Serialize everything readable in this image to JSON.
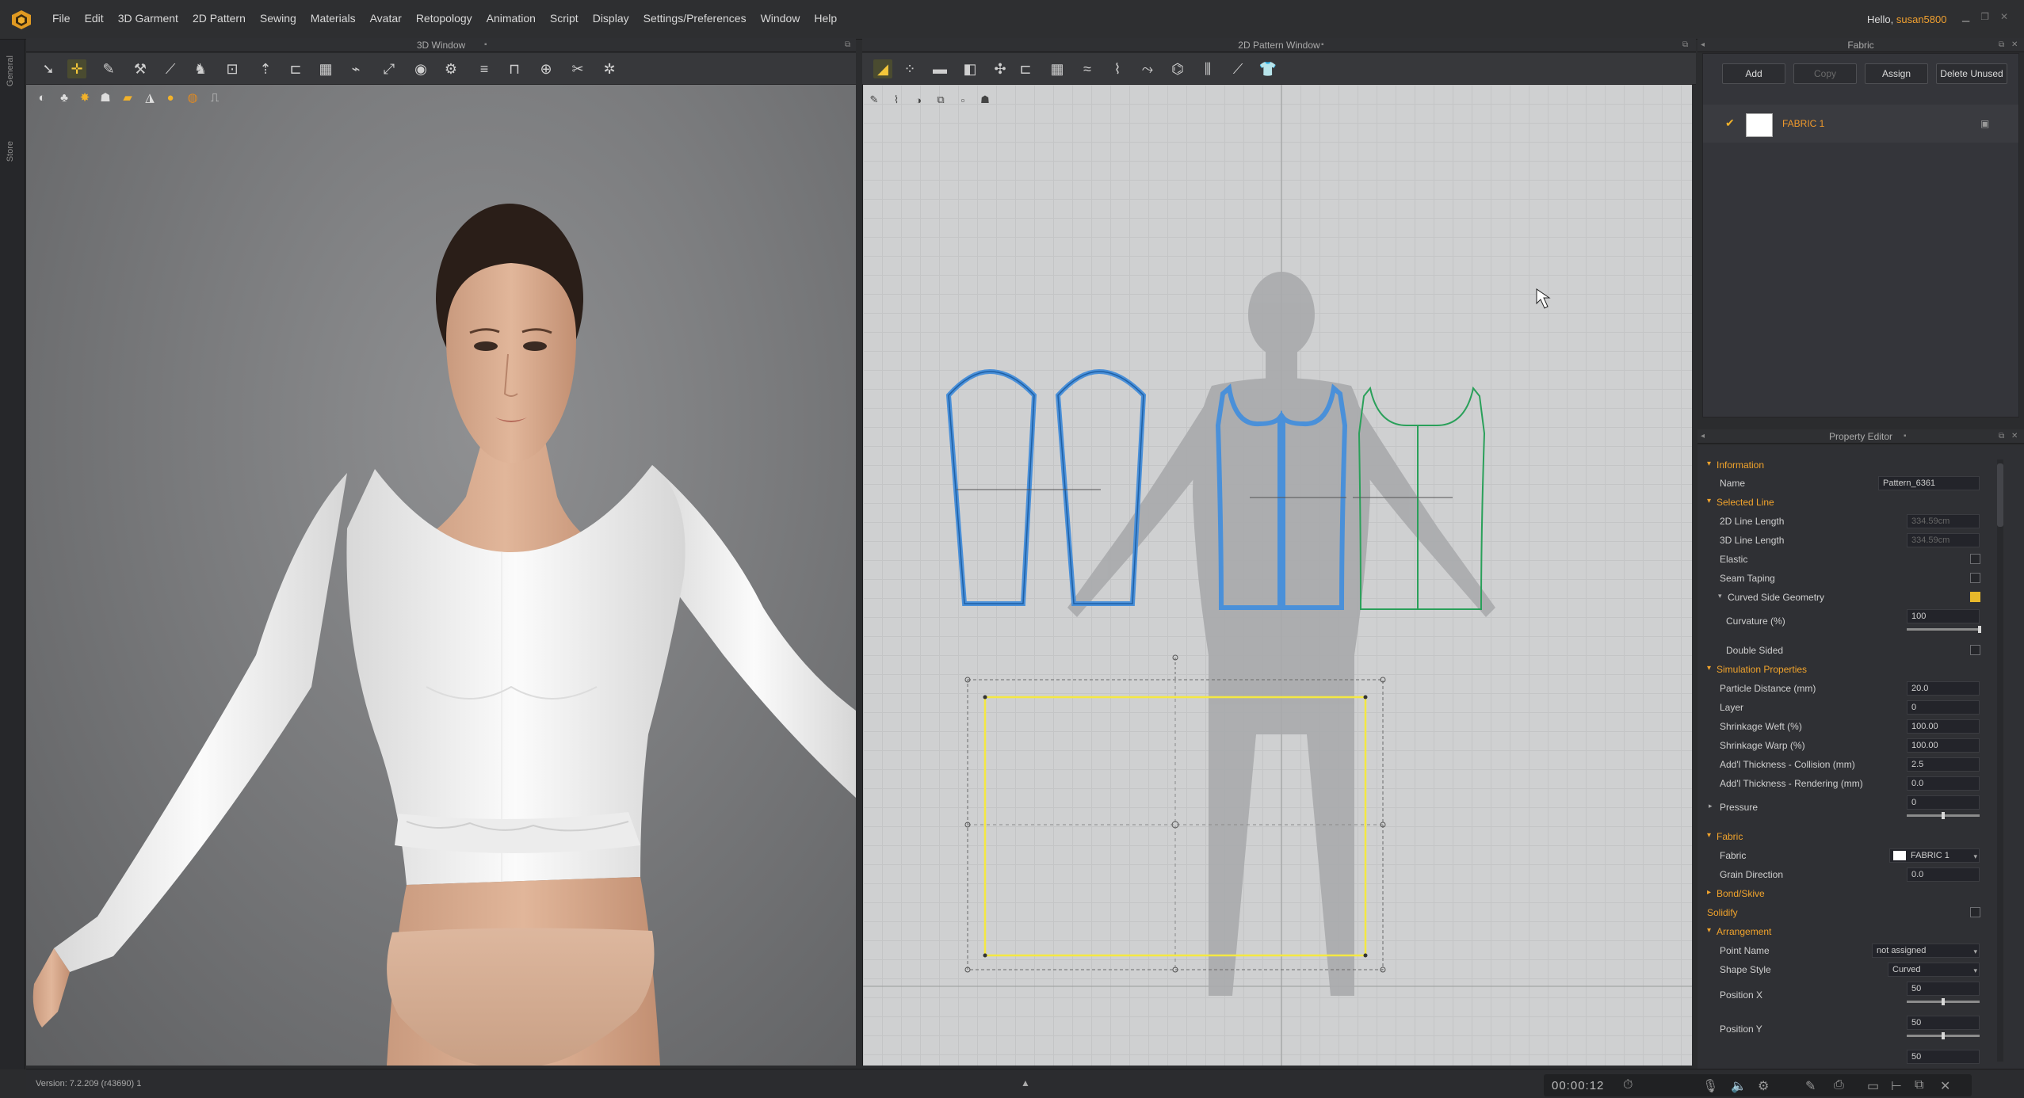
{
  "app": {
    "menus": [
      "File",
      "Edit",
      "3D Garment",
      "2D Pattern",
      "Sewing",
      "Materials",
      "Avatar",
      "Retopology",
      "Animation",
      "Script",
      "Display",
      "Settings/Preferences",
      "Window",
      "Help"
    ],
    "hello_prefix": "Hello, ",
    "username": "susan5800"
  },
  "left_tabs": [
    "General",
    "Store"
  ],
  "panels": {
    "window3d_title": "3D Window",
    "window2d_title": "2D Pattern Window",
    "fabric_title": "Fabric",
    "property_title": "Property Editor"
  },
  "fabric": {
    "buttons": [
      {
        "label": "Add",
        "enabled": true
      },
      {
        "label": "Copy",
        "enabled": false
      },
      {
        "label": "Assign",
        "enabled": true
      },
      {
        "label": "Delete Unused",
        "enabled": true
      }
    ],
    "items": [
      {
        "name": "FABRIC 1",
        "swatch_color": "#ffffff"
      }
    ]
  },
  "property": {
    "information": "Information",
    "name_label": "Name",
    "name_value": "Pattern_6361",
    "selected_line": "Selected Line",
    "line2d_label": "2D Line Length",
    "line2d_value": "334.59cm",
    "line3d_label": "3D Line Length",
    "line3d_value": "334.59cm",
    "elastic_label": "Elastic",
    "seam_taping_label": "Seam Taping",
    "curved_side_label": "Curved Side Geometry",
    "curvature_label": "Curvature (%)",
    "curvature_value": "100",
    "curvature_level": 1.0,
    "double_sided_label": "Double Sided",
    "sim_props": "Simulation Properties",
    "particle_label": "Particle Distance (mm)",
    "particle_value": "20.0",
    "layer_label": "Layer",
    "layer_value": "0",
    "shrink_weft_label": "Shrinkage Weft (%)",
    "shrink_weft_value": "100.00",
    "shrink_warp_label": "Shrinkage Warp (%)",
    "shrink_warp_value": "100.00",
    "thick_coll_label": "Add'l Thickness - Collision (mm)",
    "thick_coll_value": "2.5",
    "thick_rend_label": "Add'l Thickness - Rendering (mm)",
    "thick_rend_value": "0.0",
    "pressure_label": "Pressure",
    "pressure_value": "0",
    "pressure_level": 0.5,
    "fabric_section": "Fabric",
    "fabric_label": "Fabric",
    "fabric_value": "FABRIC 1",
    "grain_label": "Grain Direction",
    "grain_value": "0.0",
    "bond_skive": "Bond/Skive",
    "solidify": "Solidify",
    "arrangement": "Arrangement",
    "point_name_label": "Point Name",
    "point_name_value": "not assigned",
    "shape_style_label": "Shape Style",
    "shape_style_value": "Curved",
    "pos_x_label": "Position X",
    "pos_x_value": "50",
    "pos_x_level": 0.5,
    "pos_y_label": "Position Y",
    "pos_y_value": "50",
    "pos_y_level": 0.5,
    "last_value": "50"
  },
  "status": {
    "version": "Version:    7.2.209 (r43690)   1",
    "timer": "00:00:12"
  },
  "colors": {
    "accent_orange": "#f2a42c",
    "selected_outline_blue": "#4a90d9",
    "pattern_green": "#2aa05a",
    "selection_yellow": "#f4e842"
  }
}
